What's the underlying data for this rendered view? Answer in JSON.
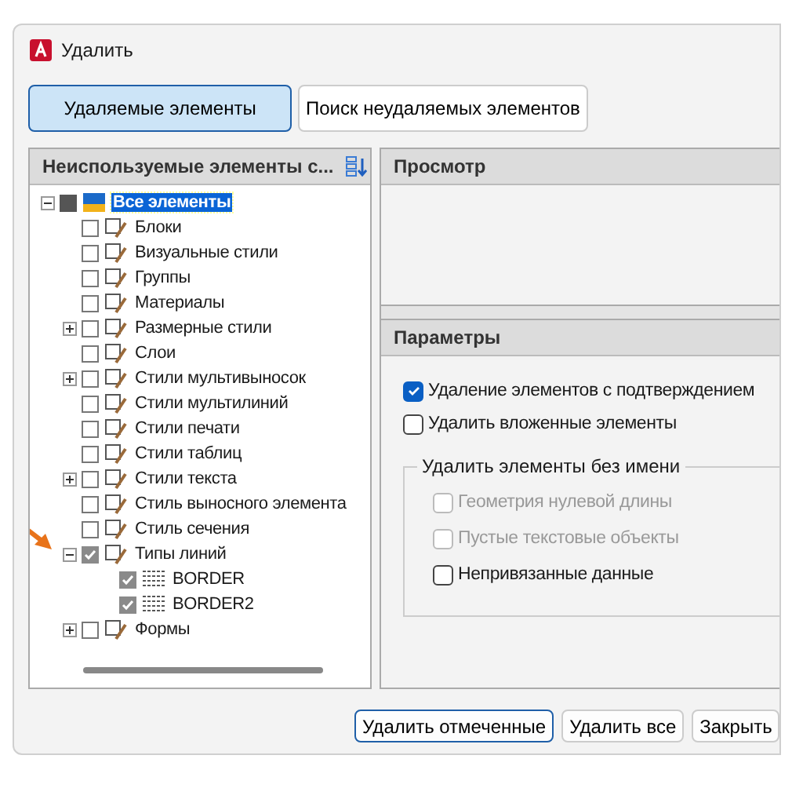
{
  "window": {
    "title": "Удалить"
  },
  "tabs": [
    {
      "label": "Удаляемые элементы",
      "selected": true
    },
    {
      "label": "Поиск неудаляемых элементов",
      "selected": false
    }
  ],
  "tree": {
    "header": "Неиспользуемые элементы с...",
    "root": {
      "label": "Все элементы",
      "expanded": true,
      "partial": true,
      "selected": true,
      "children": [
        {
          "label": "Блоки",
          "checked": false
        },
        {
          "label": "Визуальные стили",
          "checked": false
        },
        {
          "label": "Группы",
          "checked": false
        },
        {
          "label": "Материалы",
          "checked": false
        },
        {
          "label": "Размерные стили",
          "checked": false,
          "expanded": false
        },
        {
          "label": "Слои",
          "checked": false
        },
        {
          "label": "Стили мультивыносок",
          "checked": false,
          "expanded": false
        },
        {
          "label": "Стили мультилиний",
          "checked": false
        },
        {
          "label": "Стили печати",
          "checked": false
        },
        {
          "label": "Стили таблиц",
          "checked": false
        },
        {
          "label": "Стили текста",
          "checked": false,
          "expanded": false
        },
        {
          "label": "Стиль выносного элемента",
          "checked": false
        },
        {
          "label": "Стиль сечения",
          "checked": false
        },
        {
          "label": "Типы линий",
          "checked": true,
          "expanded": true,
          "children": [
            {
              "label": "BORDER",
              "checked": true
            },
            {
              "label": "BORDER2",
              "checked": true
            }
          ]
        },
        {
          "label": "Формы",
          "checked": false,
          "expanded": false
        }
      ]
    }
  },
  "preview": {
    "header": "Просмотр"
  },
  "params": {
    "header": "Параметры",
    "options": [
      {
        "label": "Удаление элементов с подтверждением",
        "checked": true,
        "disabled": false
      },
      {
        "label": "Удалить вложенные элементы",
        "checked": false,
        "disabled": false
      }
    ],
    "group": {
      "title": "Удалить элементы без имени",
      "options": [
        {
          "label": "Геометрия нулевой длины",
          "checked": false,
          "disabled": true
        },
        {
          "label": "Пустые текстовые объекты",
          "checked": false,
          "disabled": true
        },
        {
          "label": "Непривязанные данные",
          "checked": false,
          "disabled": false
        }
      ]
    }
  },
  "buttons": [
    {
      "label": "Удалить отмеченные",
      "selected": true
    },
    {
      "label": "Удалить все",
      "selected": false
    },
    {
      "label": "Закрыть",
      "selected": false
    }
  ]
}
